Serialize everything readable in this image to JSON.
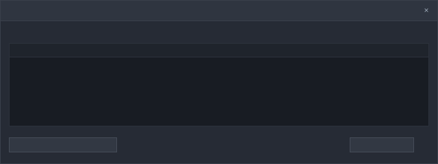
{
  "window": {
    "title": "",
    "close_glyph": "×"
  },
  "description": "",
  "table": {
    "columns": [
      "",
      "",
      "",
      "",
      ""
    ],
    "rows": [
      [
        "",
        "",
        "",
        "",
        ""
      ],
      [
        "",
        "",
        "",
        "",
        ""
      ],
      [
        "",
        "",
        "",
        "",
        ""
      ]
    ]
  },
  "footer": {
    "left_button": "",
    "right_button": ""
  },
  "icons": {
    "close": "close-icon"
  },
  "colors": {
    "background": "#262b35",
    "table_background": "#181c23",
    "button_background": "#323843"
  }
}
